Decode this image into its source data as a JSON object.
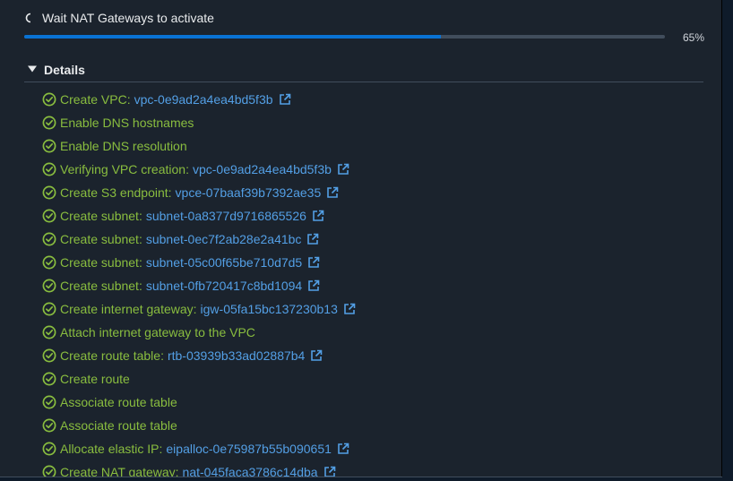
{
  "header": {
    "title": "Wait NAT Gateways to activate"
  },
  "progress": {
    "percent": 65,
    "label": "65%"
  },
  "details": {
    "title": "Details"
  },
  "colors": {
    "success": "#89bd3f",
    "link": "#539fe5",
    "accent": "#0972d3"
  },
  "steps": [
    {
      "label": "Create VPC:",
      "link": "vpc-0e9ad2a4ea4bd5f3b"
    },
    {
      "label": "Enable DNS hostnames",
      "link": null
    },
    {
      "label": "Enable DNS resolution",
      "link": null
    },
    {
      "label": "Verifying VPC creation:",
      "link": "vpc-0e9ad2a4ea4bd5f3b"
    },
    {
      "label": "Create S3 endpoint:",
      "link": "vpce-07baaf39b7392ae35"
    },
    {
      "label": "Create subnet:",
      "link": "subnet-0a8377d9716865526"
    },
    {
      "label": "Create subnet:",
      "link": "subnet-0ec7f2ab28e2a41bc"
    },
    {
      "label": "Create subnet:",
      "link": "subnet-05c00f65be710d7d5"
    },
    {
      "label": "Create subnet:",
      "link": "subnet-0fb720417c8bd1094"
    },
    {
      "label": "Create internet gateway:",
      "link": "igw-05fa15bc137230b13"
    },
    {
      "label": "Attach internet gateway to the VPC",
      "link": null
    },
    {
      "label": "Create route table:",
      "link": "rtb-03939b33ad02887b4"
    },
    {
      "label": "Create route",
      "link": null
    },
    {
      "label": "Associate route table",
      "link": null
    },
    {
      "label": "Associate route table",
      "link": null
    },
    {
      "label": "Allocate elastic IP:",
      "link": "eipalloc-0e75987b55b090651"
    },
    {
      "label": "Create NAT gateway:",
      "link": "nat-045faca3786c14dba"
    }
  ]
}
